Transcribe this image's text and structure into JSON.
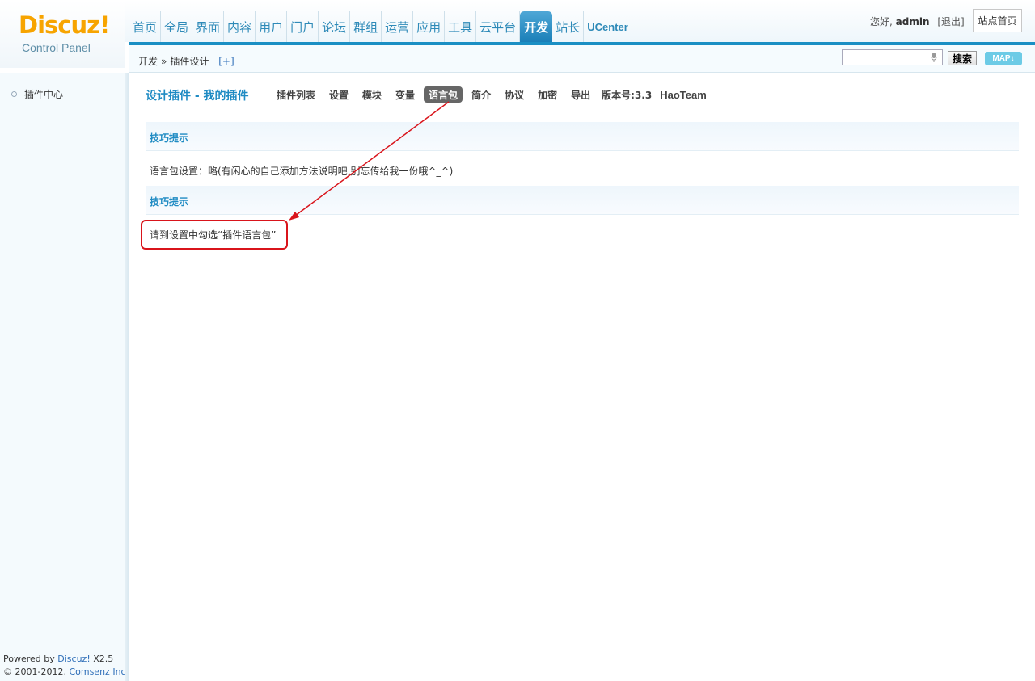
{
  "logo": {
    "brand": "Discuz!",
    "subtitle": "Control Panel"
  },
  "nav": {
    "items": [
      {
        "label": "首页"
      },
      {
        "label": "全局"
      },
      {
        "label": "界面"
      },
      {
        "label": "内容"
      },
      {
        "label": "用户"
      },
      {
        "label": "门户"
      },
      {
        "label": "论坛"
      },
      {
        "label": "群组"
      },
      {
        "label": "运营"
      },
      {
        "label": "应用"
      },
      {
        "label": "工具"
      },
      {
        "label": "云平台"
      },
      {
        "label": "开发"
      },
      {
        "label": "站长"
      },
      {
        "label": "UCenter"
      }
    ],
    "active_label": "开发"
  },
  "userbar": {
    "greeting": "您好,",
    "username": "admin",
    "logout_label": "[退出]",
    "site_home_label": "站点首页"
  },
  "breadcrumb": {
    "items": [
      "开发",
      "插件设计"
    ],
    "separator": "»",
    "add_label": "[+]"
  },
  "search": {
    "value": "",
    "button_label": "搜索",
    "map_label": "MAP"
  },
  "sidebar": {
    "items": [
      {
        "label": "插件中心"
      }
    ]
  },
  "footer": {
    "powered_prefix": "Powered by",
    "product": "Discuz!",
    "version": "X2.5",
    "copyright": "© 2001-2012,",
    "company": "Comsenz Inc."
  },
  "main": {
    "title": "设计插件 - 我的插件",
    "tabs": [
      {
        "label": "插件列表"
      },
      {
        "label": "设置"
      },
      {
        "label": "模块"
      },
      {
        "label": "变量"
      },
      {
        "label": "语言包"
      },
      {
        "label": "简介"
      },
      {
        "label": "协议"
      },
      {
        "label": "加密"
      },
      {
        "label": "导出"
      }
    ],
    "active_tab": "语言包",
    "version": "版本号:3.3",
    "team": "HaoTeam",
    "tips": [
      {
        "heading": "技巧提示",
        "text": "语言包设置：略(有闲心的自己添加方法说明吧,别忘传给我一份哦^_^)"
      },
      {
        "heading": "技巧提示",
        "text": "请到设置中勾选“插件语言包”"
      }
    ]
  },
  "colors": {
    "accent": "#1f8bc3",
    "nav_active": "#1a7fb8",
    "logo": "#f7a400",
    "annotation": "#d9141b"
  }
}
